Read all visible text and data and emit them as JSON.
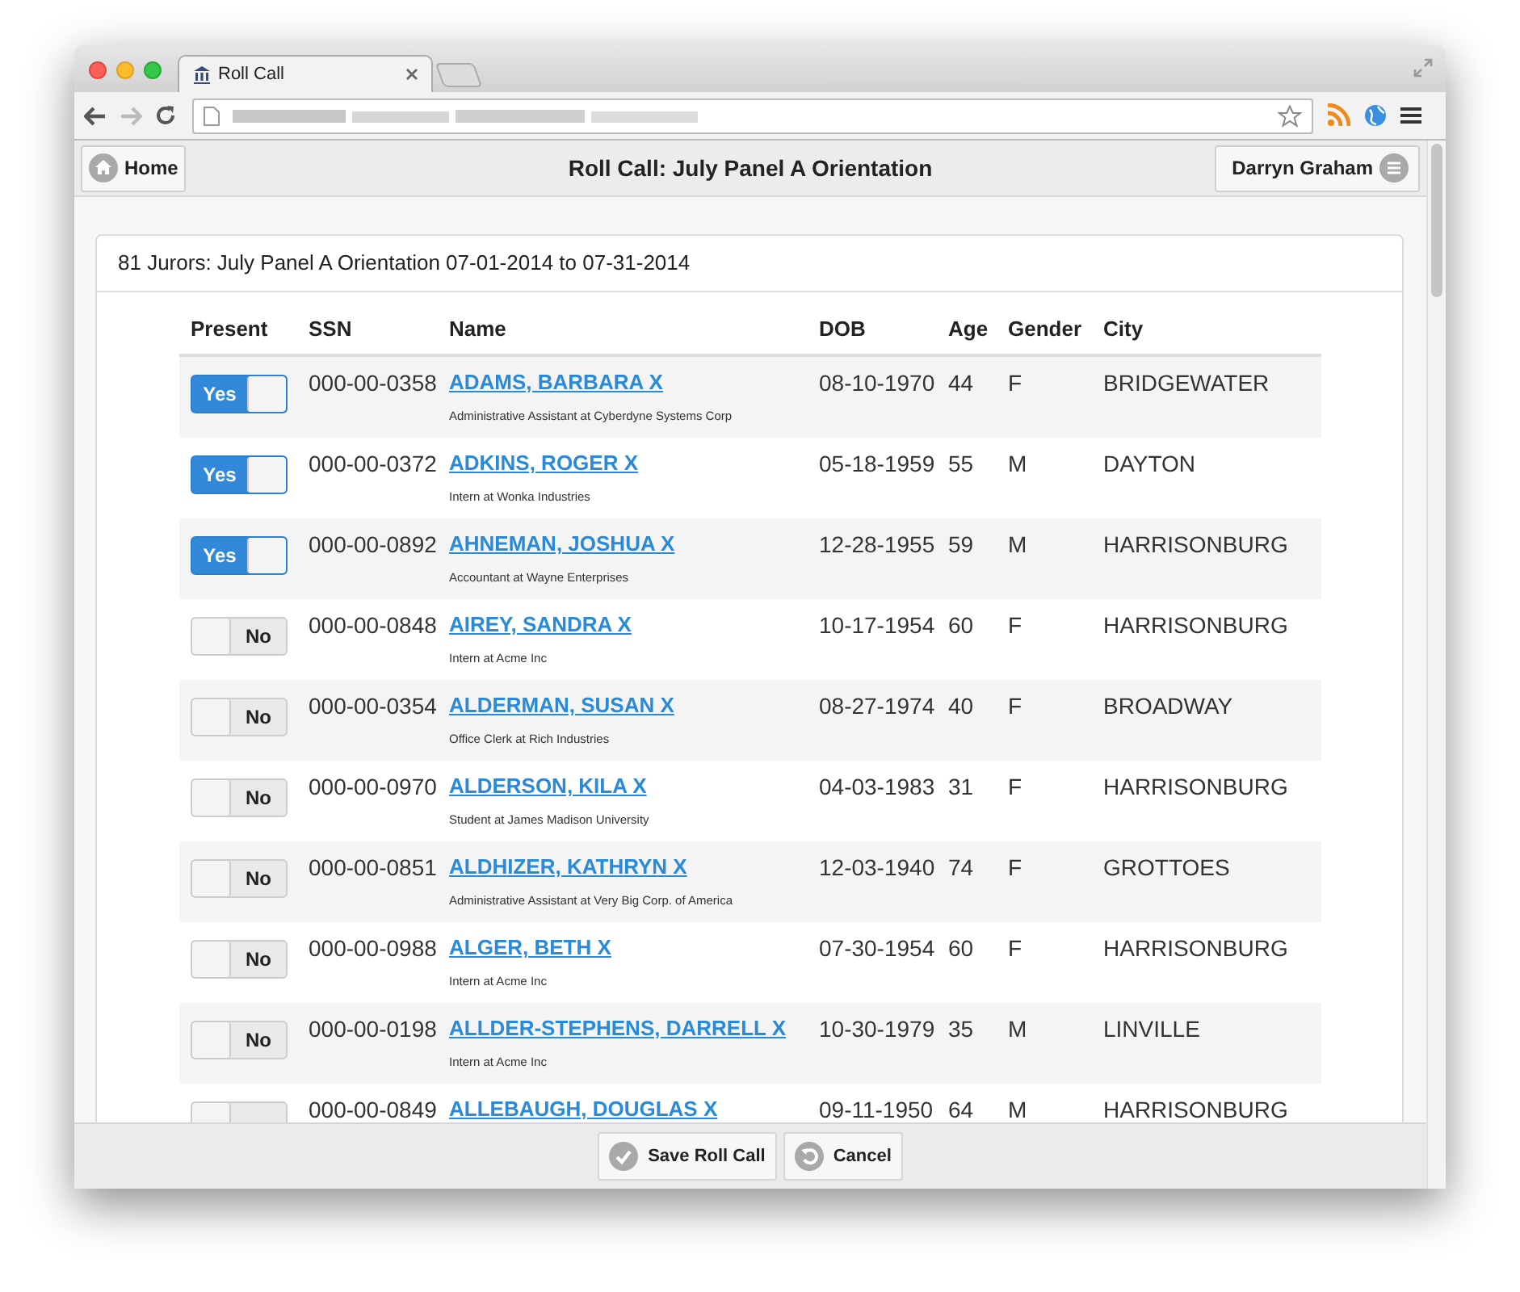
{
  "browser": {
    "tab": {
      "title": "Roll Call"
    }
  },
  "header": {
    "home_button": "Home",
    "title": "Roll Call: July Panel A Orientation",
    "user_button": "Darryn Graham"
  },
  "panel": {
    "heading": "81 Jurors: July Panel A Orientation 07-01-2014 to 07-31-2014"
  },
  "table": {
    "columns": [
      "Present",
      "SSN",
      "Name",
      "DOB",
      "Age",
      "Gender",
      "City"
    ],
    "rows": [
      {
        "present": true,
        "toggle_label": "Yes",
        "ssn": "000-00-0358",
        "name": "ADAMS, BARBARA X",
        "job": "Administrative Assistant at Cyberdyne Systems Corp",
        "dob": "08-10-1970",
        "age": "44",
        "gender": "F",
        "city": "BRIDGEWATER"
      },
      {
        "present": true,
        "toggle_label": "Yes",
        "ssn": "000-00-0372",
        "name": "ADKINS, ROGER X",
        "job": "Intern at Wonka Industries",
        "dob": "05-18-1959",
        "age": "55",
        "gender": "M",
        "city": "DAYTON"
      },
      {
        "present": true,
        "toggle_label": "Yes",
        "ssn": "000-00-0892",
        "name": "AHNEMAN, JOSHUA X",
        "job": "Accountant at Wayne Enterprises",
        "dob": "12-28-1955",
        "age": "59",
        "gender": "M",
        "city": "HARRISONBURG"
      },
      {
        "present": false,
        "toggle_label": "No",
        "ssn": "000-00-0848",
        "name": "AIREY, SANDRA X",
        "job": "Intern at Acme Inc",
        "dob": "10-17-1954",
        "age": "60",
        "gender": "F",
        "city": "HARRISONBURG"
      },
      {
        "present": false,
        "toggle_label": "No",
        "ssn": "000-00-0354",
        "name": "ALDERMAN, SUSAN X",
        "job": "Office Clerk at Rich Industries",
        "dob": "08-27-1974",
        "age": "40",
        "gender": "F",
        "city": "BROADWAY"
      },
      {
        "present": false,
        "toggle_label": "No",
        "ssn": "000-00-0970",
        "name": "ALDERSON, KILA X",
        "job": "Student at James Madison University",
        "dob": "04-03-1983",
        "age": "31",
        "gender": "F",
        "city": "HARRISONBURG"
      },
      {
        "present": false,
        "toggle_label": "No",
        "ssn": "000-00-0851",
        "name": "ALDHIZER, KATHRYN X",
        "job": "Administrative Assistant at Very Big Corp. of America",
        "dob": "12-03-1940",
        "age": "74",
        "gender": "F",
        "city": "GROTTOES"
      },
      {
        "present": false,
        "toggle_label": "No",
        "ssn": "000-00-0988",
        "name": "ALGER, BETH X",
        "job": "Intern at Acme Inc",
        "dob": "07-30-1954",
        "age": "60",
        "gender": "F",
        "city": "HARRISONBURG"
      },
      {
        "present": false,
        "toggle_label": "No",
        "ssn": "000-00-0198",
        "name": "ALLDER-STEPHENS, DARRELL X",
        "job": "Intern at Acme Inc",
        "dob": "10-30-1979",
        "age": "35",
        "gender": "M",
        "city": "LINVILLE"
      },
      {
        "present": false,
        "ssn": "000-00-0849",
        "name": "ALLEBAUGH, DOUGLAS X",
        "dob": "09-11-1950",
        "age": "64",
        "gender": "M",
        "city": "HARRISONBURG"
      }
    ]
  },
  "footer": {
    "buttons": [
      {
        "kind": "save",
        "label": "Save Roll Call"
      },
      {
        "kind": "cancel",
        "label": "Cancel"
      }
    ]
  }
}
